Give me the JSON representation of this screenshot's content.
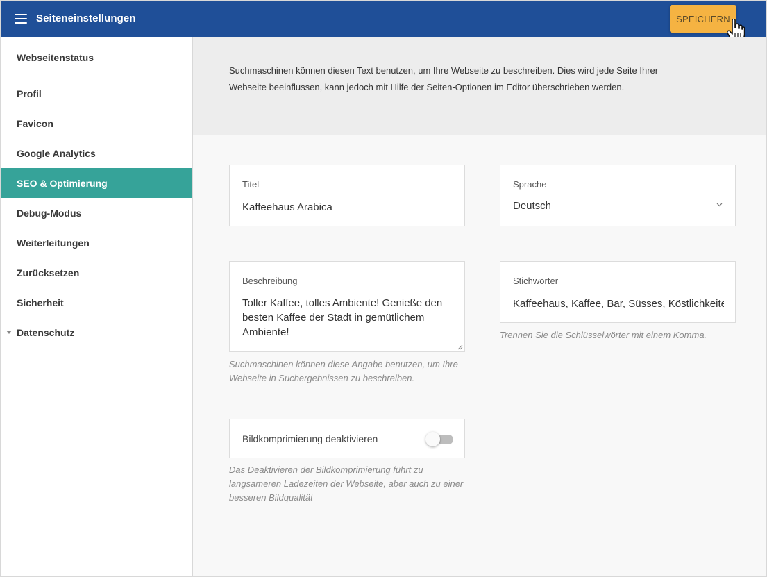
{
  "header": {
    "title": "Seiteneinstellungen",
    "save_label": "SPEICHERN",
    "background_color": "#1f4f98",
    "save_color": "#f5b342"
  },
  "sidebar": {
    "active_color": "#36a399",
    "items": [
      {
        "label": "Webseitenstatus"
      },
      {
        "label": "Profil"
      },
      {
        "label": "Favicon"
      },
      {
        "label": "Google Analytics"
      },
      {
        "label": "SEO & Optimierung",
        "active": true
      },
      {
        "label": "Debug-Modus"
      },
      {
        "label": "Weiterleitungen"
      },
      {
        "label": "Zurücksetzen"
      },
      {
        "label": "Sicherheit"
      },
      {
        "label": "Datenschutz",
        "collapsible": true
      }
    ]
  },
  "main": {
    "intro": "Suchmaschinen können diesen Text benutzen, um Ihre Webseite zu beschreiben. Dies wird jede Seite Ihrer Webseite beeinflussen, kann jedoch mit Hilfe der Seiten-Optionen im Editor überschrieben werden.",
    "title_field": {
      "label": "Titel",
      "value": "Kaffeehaus Arabica"
    },
    "language_field": {
      "label": "Sprache",
      "value": "Deutsch"
    },
    "description_field": {
      "label": "Beschreibung",
      "value": "Toller Kaffee, tolles Ambiente! Genieße den besten Kaffee der Stadt in gemütlichem Ambiente!",
      "hint": "Suchmaschinen können diese Angabe benutzen, um Ihre Webseite in Suchergebnissen zu beschreiben."
    },
    "keywords_field": {
      "label": "Stichwörter",
      "value": "Kaffeehaus, Kaffee, Bar, Süsses, Köstlichkeiten",
      "hint": "Trennen Sie die Schlüsselwörter mit einem Komma."
    },
    "compression_toggle": {
      "label": "Bildkomprimierung deaktivieren",
      "enabled": false,
      "hint": "Das Deaktivieren der Bildkomprimierung führt zu langsameren Ladezeiten der Webseite, aber auch zu einer besseren Bildqualität"
    }
  }
}
